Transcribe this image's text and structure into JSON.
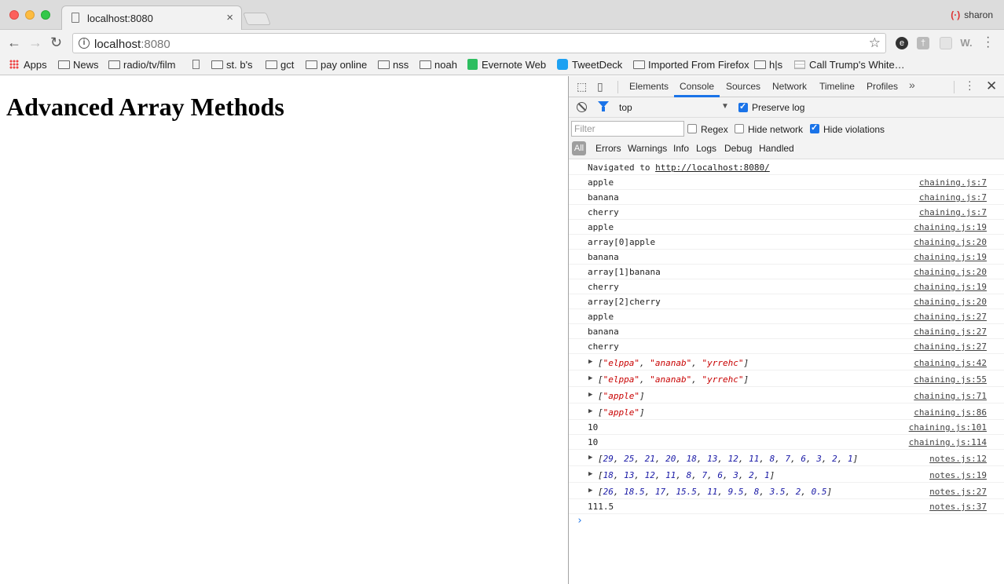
{
  "tab": {
    "title": "localhost:8080",
    "close": "×"
  },
  "profile": {
    "name": "sharon",
    "icon": "(·)"
  },
  "address": {
    "host": "localhost",
    "port": ":8080"
  },
  "extensions": {
    "ext4": "W."
  },
  "bookmarks": [
    {
      "label": "Apps",
      "icon": "apps-grid-icon"
    },
    {
      "label": "News",
      "icon": "folder-icon"
    },
    {
      "label": "radio/tv/film",
      "icon": "folder-icon"
    },
    {
      "label": "",
      "icon": "page-icon"
    },
    {
      "label": "st. b's",
      "icon": "folder-icon"
    },
    {
      "label": "gct",
      "icon": "folder-icon"
    },
    {
      "label": "pay online",
      "icon": "folder-icon"
    },
    {
      "label": "nss",
      "icon": "folder-icon"
    },
    {
      "label": "noah",
      "icon": "folder-icon"
    },
    {
      "label": "Evernote Web",
      "icon": "evernote-icon"
    },
    {
      "label": "TweetDeck",
      "icon": "tweetdeck-icon"
    },
    {
      "label": "Imported From Firefox",
      "icon": "folder-icon"
    },
    {
      "label": "h|s",
      "icon": "folder-icon"
    },
    {
      "label": "Call Trump's White…",
      "icon": "whitehouse-icon"
    }
  ],
  "page": {
    "heading": "Advanced Array Methods"
  },
  "devtools": {
    "tabs": [
      "Elements",
      "Console",
      "Sources",
      "Network",
      "Timeline",
      "Profiles"
    ],
    "active_tab": "Console",
    "context": "top",
    "preserve_log": "Preserve log",
    "filter_placeholder": "Filter",
    "regex": "Regex",
    "hide_network": "Hide network",
    "hide_violations": "Hide violations",
    "levels": [
      "All",
      "Errors",
      "Warnings",
      "Info",
      "Logs",
      "Debug",
      "Handled"
    ]
  },
  "console": {
    "navigated": {
      "prefix": "Navigated to ",
      "url": "http://localhost:8080/"
    },
    "logs": [
      {
        "msg": "apple",
        "src": "chaining.js:7"
      },
      {
        "msg": "banana",
        "src": "chaining.js:7"
      },
      {
        "msg": "cherry",
        "src": "chaining.js:7"
      },
      {
        "msg": "apple",
        "src": "chaining.js:19"
      },
      {
        "msg": "array[0]apple",
        "src": "chaining.js:20"
      },
      {
        "msg": "banana",
        "src": "chaining.js:19"
      },
      {
        "msg": "array[1]banana",
        "src": "chaining.js:20"
      },
      {
        "msg": "cherry",
        "src": "chaining.js:19"
      },
      {
        "msg": "array[2]cherry",
        "src": "chaining.js:20"
      },
      {
        "msg": "apple",
        "src": "chaining.js:27"
      },
      {
        "msg": "banana",
        "src": "chaining.js:27"
      },
      {
        "msg": "cherry",
        "src": "chaining.js:27"
      }
    ],
    "str_arrays": [
      {
        "items": [
          "elppa",
          "ananab",
          "yrrehc"
        ],
        "src": "chaining.js:42"
      },
      {
        "items": [
          "elppa",
          "ananab",
          "yrrehc"
        ],
        "src": "chaining.js:55"
      },
      {
        "items": [
          "apple"
        ],
        "src": "chaining.js:71"
      },
      {
        "items": [
          "apple"
        ],
        "src": "chaining.js:86"
      }
    ],
    "numbers": [
      {
        "msg": "10",
        "src": "chaining.js:101"
      },
      {
        "msg": "10",
        "src": "chaining.js:114"
      }
    ],
    "num_arrays": [
      {
        "items": [
          "29",
          "25",
          "21",
          "20",
          "18",
          "13",
          "12",
          "11",
          "8",
          "7",
          "6",
          "3",
          "2",
          "1"
        ],
        "src": "notes.js:12"
      },
      {
        "items": [
          "18",
          "13",
          "12",
          "11",
          "8",
          "7",
          "6",
          "3",
          "2",
          "1"
        ],
        "src": "notes.js:19"
      },
      {
        "items": [
          "26",
          "18.5",
          "17",
          "15.5",
          "11",
          "9.5",
          "8",
          "3.5",
          "2",
          "0.5"
        ],
        "src": "notes.js:27"
      }
    ],
    "final": {
      "msg": "111.5",
      "src": "notes.js:37"
    },
    "prompt": "›"
  }
}
